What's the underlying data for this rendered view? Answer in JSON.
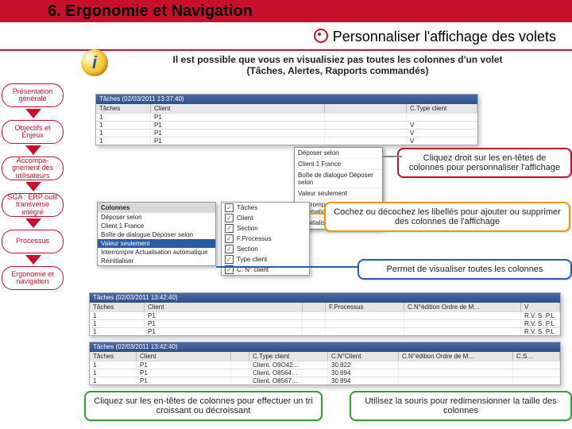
{
  "title": "6. Ergonomie et Navigation",
  "subtitle": "Personnaliser l'affichage des volets",
  "info": {
    "line1": "Il est possible que vous en visualisiez pas toutes les colonnes d'un volet",
    "line2": "(Tâches, Alertes, Rapports commandés)"
  },
  "sidebar": {
    "items": [
      "Présentation générale",
      "Objectifs et Enjeux",
      "Accompa-gnement des utilisateurs",
      "SGA : ERP outil transverse intégré",
      "Processus",
      "Ergonomie et navigation"
    ]
  },
  "shot1": {
    "bar": "Tâches (02/03/2011 13:37:40)",
    "headers": [
      "Tâches",
      "Client",
      "",
      "",
      "C.Type client"
    ],
    "rows": [
      [
        "1",
        "",
        "P1",
        "",
        ""
      ],
      [
        "1",
        "",
        "P1",
        "Déposer selon",
        "V"
      ],
      [
        "1",
        "",
        "P1",
        "Client 1 France",
        "V"
      ],
      [
        "1",
        "",
        "P1",
        "Boîte de dialogue Déposer selon",
        "V"
      ],
      [
        "",
        "",
        "",
        "Valeur seulement",
        ""
      ],
      [
        "",
        "",
        "",
        "Interrompre Actualisation automatique",
        ""
      ],
      [
        "",
        "",
        "",
        "Réinitialiser",
        ""
      ]
    ]
  },
  "panel": {
    "header": "Colonnes",
    "rows": [
      "Déposer selon",
      "Client 1 France",
      "Boîte de dialogue Déposer selon"
    ],
    "highlight": "Valeur seulement",
    "rows2": [
      "Interrompre Actualisation automatique",
      "Réinitialiser"
    ]
  },
  "checks": {
    "items": [
      "Tâches",
      "Client",
      "Section",
      "F.Processus",
      "Section",
      "Type client",
      "C. N° client"
    ]
  },
  "shot2": {
    "bar": "Tâches (02/03/2011 13:42:40)",
    "headers": [
      "Tâches",
      "Client",
      "",
      "F.Processus",
      "C.N°édition Ordre de M…",
      "V"
    ]
  },
  "shot3": {
    "bar": "Tâches (02/03/2011 13:42:40)",
    "headers": [
      "Tâches",
      "Client",
      "",
      "C.Type client",
      "C.N°Client",
      "C.N°édition Ordre de M…",
      "C.S…"
    ]
  },
  "callouts": {
    "c1": "Cliquez droit sur les en-têtes de colonnes pour personnaliser l'affichage",
    "c2": "Cochez ou décochez les libellés pour ajouter ou supprimer des colonnes de l'affichage",
    "c3": "Permet de visualiser toutes les colonnes",
    "c4": "Cliquez sur les en-têtes de colonnes pour effectuer un tri croissant ou décroissant",
    "c5": "Utilisez la souris pour redimensionner la taille des colonnes"
  }
}
